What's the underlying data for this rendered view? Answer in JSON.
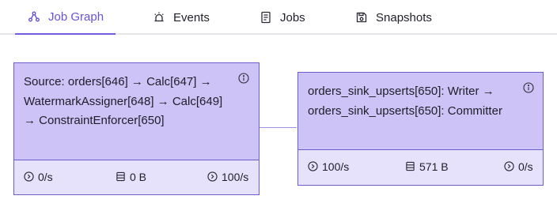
{
  "tabs": [
    {
      "label": "Job Graph",
      "icon": "graph-icon",
      "active": true
    },
    {
      "label": "Events",
      "icon": "alarm-icon",
      "active": false
    },
    {
      "label": "Jobs",
      "icon": "document-icon",
      "active": false
    },
    {
      "label": "Snapshots",
      "icon": "save-icon",
      "active": false
    }
  ],
  "colors": {
    "accent": "#6753d6",
    "node_header": "#cdc3f6",
    "node_body": "#e7e2fb",
    "node_border": "#6b5cd0"
  },
  "nodes": [
    {
      "title": "Source: orders[646] → Calc[647] → WatermarkAssigner[648] → Calc[649] → ConstraintEnforcer[650]",
      "metrics": {
        "input_rate": "0/s",
        "state_size": "0 B",
        "output_rate": "100/s"
      }
    },
    {
      "title": "orders_sink_upserts[650]: Writer → orders_sink_upserts[650]: Committer",
      "metrics": {
        "input_rate": "100/s",
        "state_size": "571 B",
        "output_rate": "0/s"
      }
    }
  ]
}
